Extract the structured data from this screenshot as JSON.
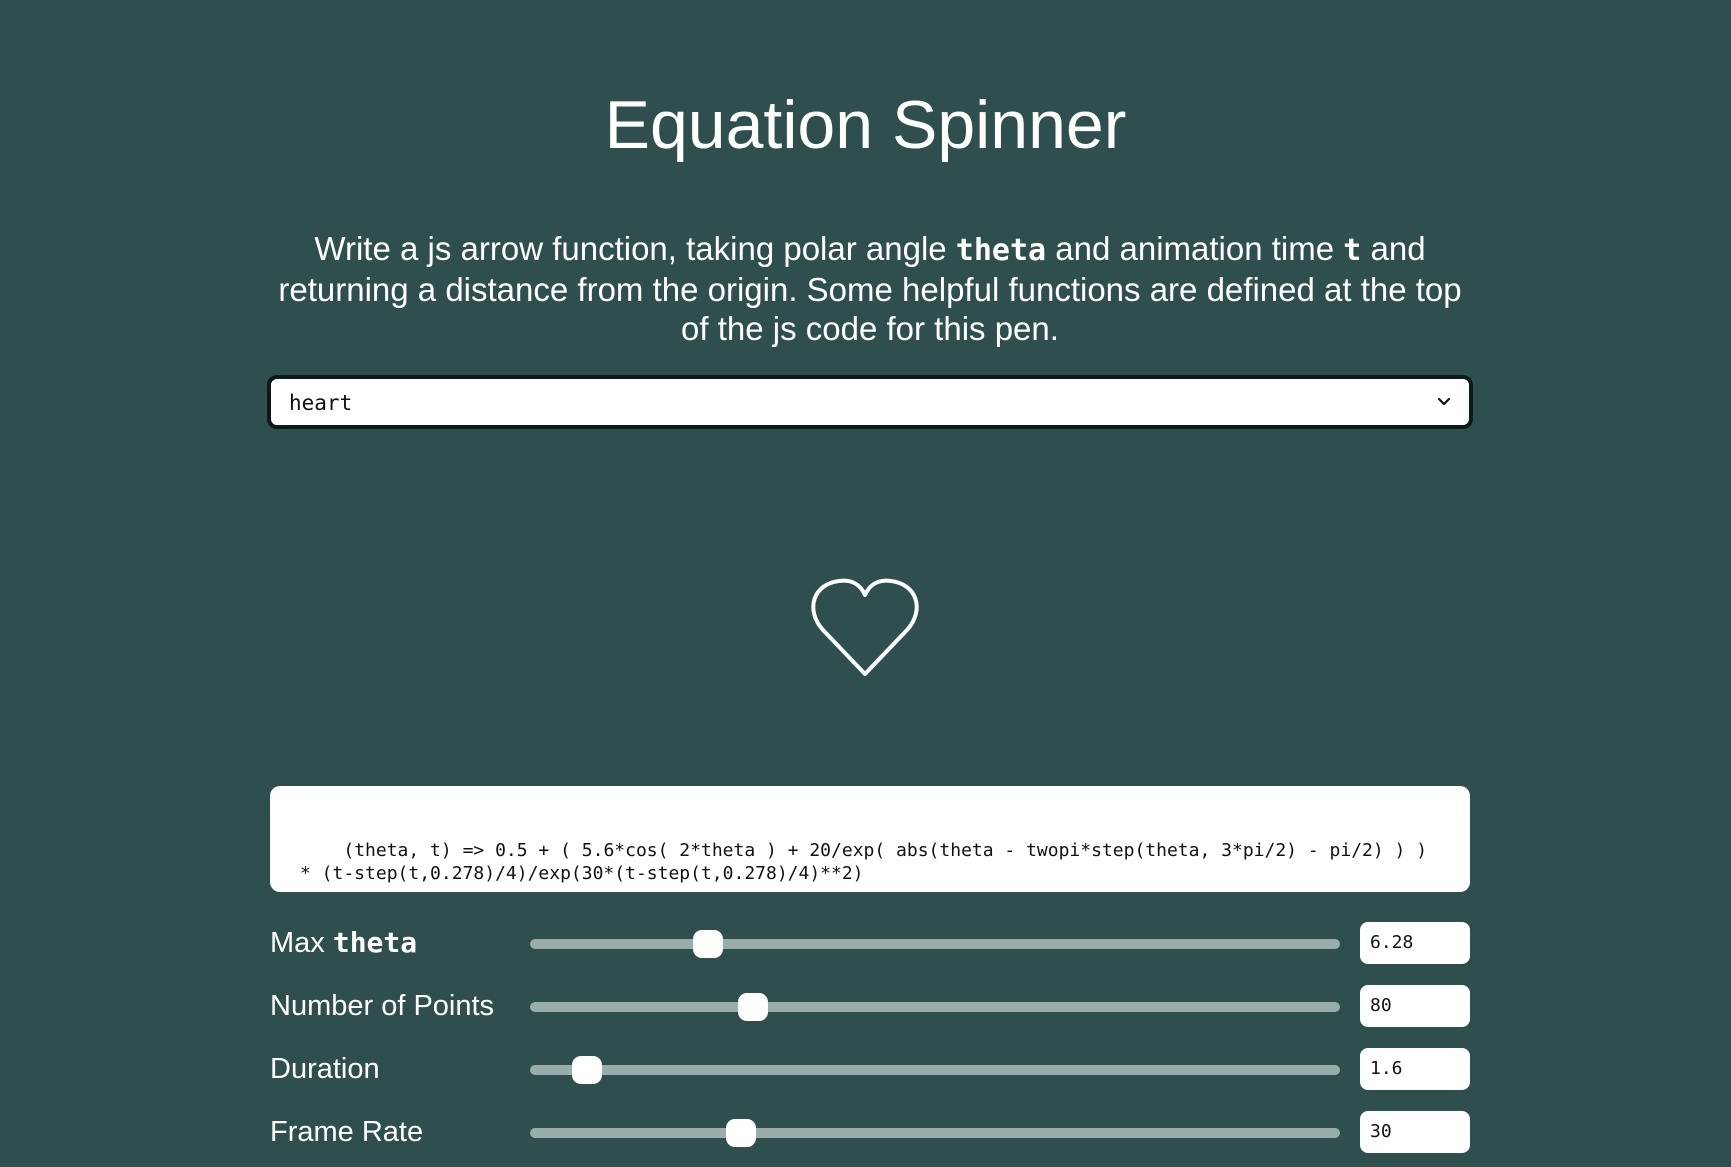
{
  "page": {
    "title": "Equation Spinner"
  },
  "intro": {
    "part1": "Write a js arrow function, taking polar angle ",
    "code1": "theta",
    "part2": " and animation time ",
    "code2": "t",
    "part3": " and returning a distance from the origin. Some helpful functions are defined at the top of the js code for this pen."
  },
  "preset_select": {
    "value": "heart",
    "icon": "chevron-down-icon"
  },
  "preview": {
    "shape": "heart",
    "stroke_color": "#ffffff"
  },
  "equation": {
    "value": "(theta, t) => 0.5 + ( 5.6*cos( 2*theta ) + 20/exp( abs(theta - twopi*step(theta, 3*pi/2) - pi/2) ) ) * (t-step(t,0.278)/4)/exp(30*(t-step(t,0.278)/4)**2)"
  },
  "controls": [
    {
      "label_prefix": "Max ",
      "label_code": "theta",
      "value": "6.28",
      "slider_fraction": 0.22
    },
    {
      "label": "Number of Points",
      "value": "80",
      "slider_fraction": 0.275
    },
    {
      "label": "Duration",
      "value": "1.6",
      "slider_fraction": 0.07
    },
    {
      "label": "Frame Rate",
      "value": "30",
      "slider_fraction": 0.26
    }
  ],
  "colors": {
    "background": "#2f4f4f",
    "slider_track": "#99aeab",
    "text": "#ffffff"
  }
}
